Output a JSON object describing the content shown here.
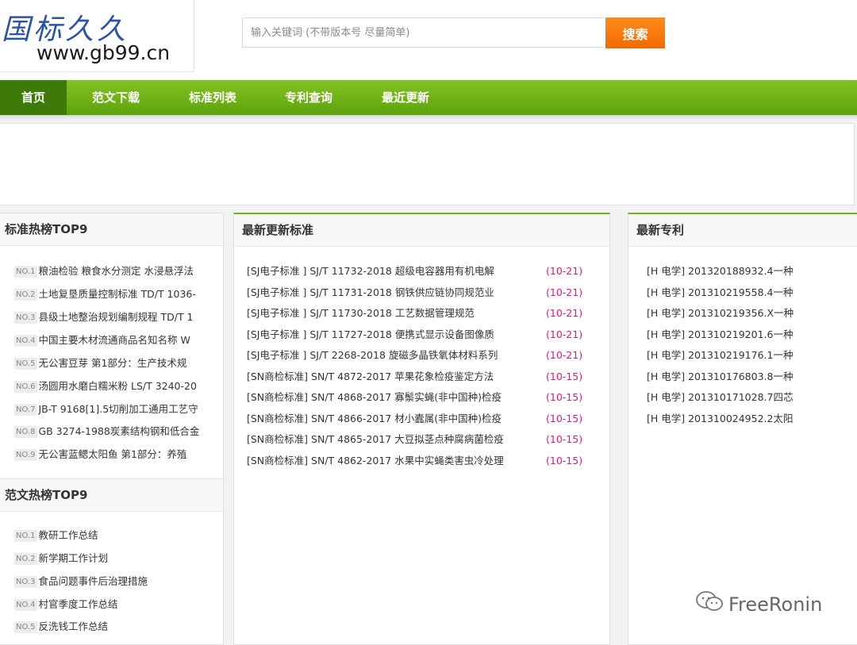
{
  "logo": {
    "cn": "国标久久",
    "url": "www.gb99.cn"
  },
  "search": {
    "placeholder": "输入关键词 (不带版本号 尽量简单)",
    "button": "搜索"
  },
  "nav": [
    "首页",
    "范文下载",
    "标准列表",
    "专利查询",
    "最近更新"
  ],
  "hot_standards": {
    "title": "标准热榜TOP9",
    "items": [
      {
        "no": "NO.1",
        "text": "粮油检验 粮食水分测定 水浸悬浮法"
      },
      {
        "no": "NO.2",
        "text": "土地复垦质量控制标准 TD/T 1036-"
      },
      {
        "no": "NO.3",
        "text": "县级土地整治规划编制规程 TD/T 1"
      },
      {
        "no": "NO.4",
        "text": "中国主要木材流通商品名知名称 W"
      },
      {
        "no": "NO.5",
        "text": "无公害豆芽 第1部分：生产技术规"
      },
      {
        "no": "NO.6",
        "text": "汤圆用水磨白糯米粉 LS/T 3240-20"
      },
      {
        "no": "NO.7",
        "text": "JB-T 9168[1].5切削加工通用工艺守"
      },
      {
        "no": "NO.8",
        "text": "GB 3274-1988炭素结构钢和低合金"
      },
      {
        "no": "NO.9",
        "text": "无公害蓝鳃太阳鱼 第1部分：养殖"
      }
    ]
  },
  "hot_essays": {
    "title": "范文热榜TOP9",
    "items": [
      {
        "no": "NO.1",
        "text": "教研工作总结"
      },
      {
        "no": "NO.2",
        "text": "新学期工作计划"
      },
      {
        "no": "NO.3",
        "text": "食品问题事件后治理措施"
      },
      {
        "no": "NO.4",
        "text": "村官季度工作总结"
      },
      {
        "no": "NO.5",
        "text": "反洗钱工作总结"
      }
    ]
  },
  "latest_standards": {
    "title": "最新更新标准",
    "rows": [
      {
        "text": "[SJ电子标准 ]  SJ/T 11732-2018 超级电容器用有机电解",
        "date": "(10-21)"
      },
      {
        "text": "[SJ电子标准 ]  SJ/T 11731-2018 钢铁供应链协同规范业",
        "date": "(10-21)"
      },
      {
        "text": "[SJ电子标准 ]  SJ/T 11730-2018 工艺数据管理规范",
        "date": "(10-21)"
      },
      {
        "text": "[SJ电子标准 ]  SJ/T 11727-2018 便携式显示设备图像质",
        "date": "(10-21)"
      },
      {
        "text": "[SJ电子标准 ]  SJ/T 2268-2018 旋磁多晶铁氧体材料系列",
        "date": "(10-21)"
      },
      {
        "text": "[SN商检标准]  SN/T 4872-2017 苹果花象检疫鉴定方法",
        "date": "(10-15)"
      },
      {
        "text": "[SN商检标准]  SN/T 4868-2017 寡鬃实蝇(非中国种)检疫",
        "date": "(10-15)"
      },
      {
        "text": "[SN商检标准]  SN/T 4866-2017 材小蠹属(非中国种)检疫",
        "date": "(10-15)"
      },
      {
        "text": "[SN商检标准]  SN/T 4865-2017 大豆拟茎点种腐病菌检疫",
        "date": "(10-15)"
      },
      {
        "text": "[SN商检标准]  SN/T 4862-2017 水果中实蝇类害虫冷处理",
        "date": "(10-15)"
      }
    ]
  },
  "latest_patents": {
    "title": "最新专利",
    "rows": [
      "[H 电学]  201320188932.4一种",
      "[H 电学]  201310219558.4一种",
      "[H 电学]  201310219356.X一种",
      "[H 电学]  201310219201.6一种",
      "[H 电学]  201310219176.1一种",
      "[H 电学]  201310176803.8一种",
      "[H 电学]  201310171028.7四芯",
      "[H 电学]  201310024952.2太阳"
    ]
  },
  "watermark": "FreeRonin",
  "colors": {
    "nav_green": "#6eb21c",
    "nav_active": "#3d7a07",
    "search_orange": "#f57a0f",
    "date_pink": "#e0187c",
    "logo_blue": "#2b53a8"
  }
}
